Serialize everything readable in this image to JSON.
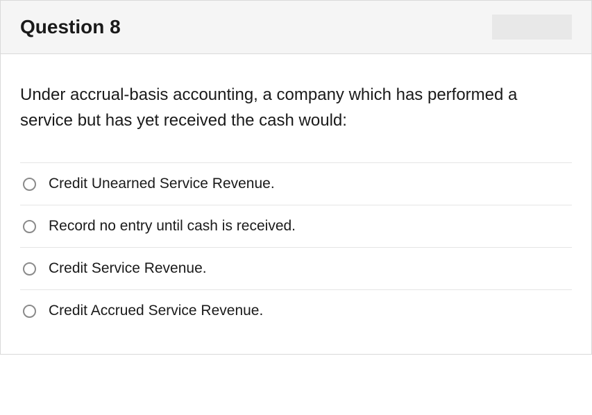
{
  "header": {
    "title": "Question 8"
  },
  "question": {
    "text": "Under accrual-basis accounting, a company which has performed a service but has yet received the cash would:"
  },
  "options": [
    {
      "label": "Credit Unearned Service Revenue."
    },
    {
      "label": "Record no entry until cash is received."
    },
    {
      "label": "Credit Service Revenue."
    },
    {
      "label": "Credit Accrued Service Revenue."
    }
  ]
}
